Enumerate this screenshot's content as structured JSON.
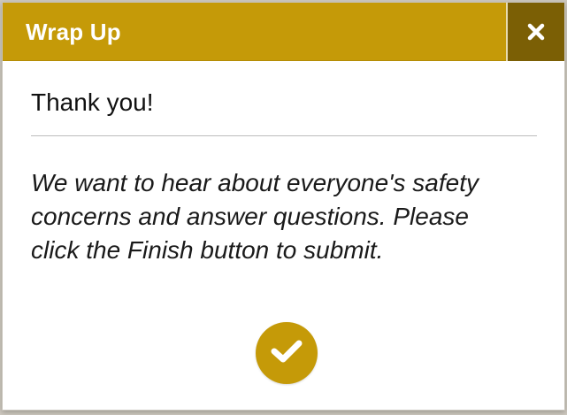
{
  "dialog": {
    "title": "Wrap Up",
    "close_icon": "close-icon",
    "heading": "Thank you!",
    "message": "We want to hear about everyone's safety concerns and answer questions. Please click the Finish button to submit.",
    "finish_icon": "checkmark-icon"
  },
  "colors": {
    "accent": "#c59a08",
    "close_bg": "#7b5f05",
    "text": "#111111"
  }
}
